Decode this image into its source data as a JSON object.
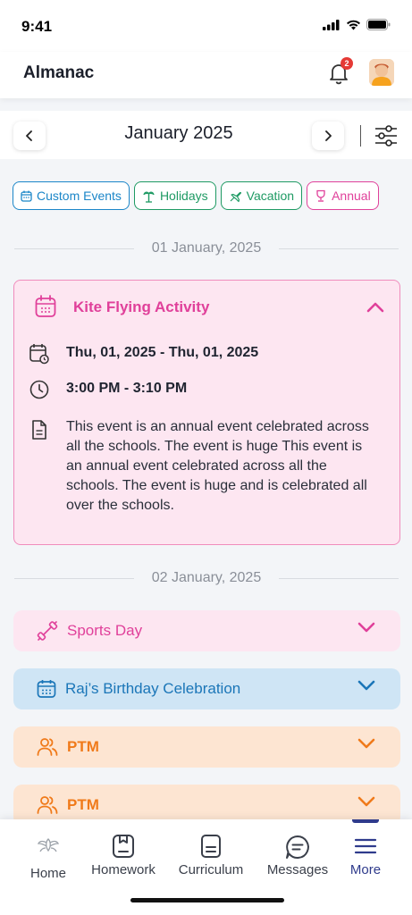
{
  "status": {
    "time": "9:41"
  },
  "header": {
    "title": "Almanac",
    "notification_count": "2"
  },
  "calendar": {
    "month": "January 2025",
    "prev_label": "‹",
    "next_label": "›"
  },
  "filters": [
    {
      "label": "Custom Events",
      "icon": "calendar-icon",
      "color": "#1b86c8"
    },
    {
      "label": "Holidays",
      "icon": "palm-tree-icon",
      "color": "#1e9a63"
    },
    {
      "label": "Vacation",
      "icon": "plane-icon",
      "color": "#1e9a63"
    },
    {
      "label": "Annual",
      "icon": "trophy-icon",
      "color": "#e0409a"
    }
  ],
  "groups": [
    {
      "date": "01 January, 2025",
      "events": [
        {
          "title": "Kite Flying Activity",
          "date_range": "Thu, 01, 2025 - Thu, 01, 2025",
          "time": "3:00 PM - 3:10 PM",
          "description": "This event is an annual event celebrated across all the schools. The event is huge This event is an annual event celebrated across all the schools. The event is huge and is celebrated all over the schools.",
          "expanded": true,
          "color": "#e0409a"
        }
      ]
    },
    {
      "date": "02 January, 2025",
      "events": [
        {
          "title": "Sports Day",
          "icon": "dumbbell-icon",
          "color": "#e0409a",
          "expanded": false
        },
        {
          "title": "Raj’s Birthday Celebration",
          "icon": "calendar-icon",
          "color": "#1b76b8",
          "expanded": false
        },
        {
          "title": "PTM",
          "icon": "people-icon",
          "color": "#f07a1a",
          "expanded": false
        },
        {
          "title": "PTM",
          "icon": "people-icon",
          "color": "#f07a1a",
          "expanded": false
        }
      ]
    }
  ],
  "tabs": [
    {
      "label": "Home",
      "icon": "home-logo-icon"
    },
    {
      "label": "Homework",
      "icon": "homework-icon"
    },
    {
      "label": "Curriculum",
      "icon": "curriculum-icon"
    },
    {
      "label": "Messages",
      "icon": "messages-icon"
    },
    {
      "label": "More",
      "icon": "menu-icon",
      "active": true
    }
  ]
}
